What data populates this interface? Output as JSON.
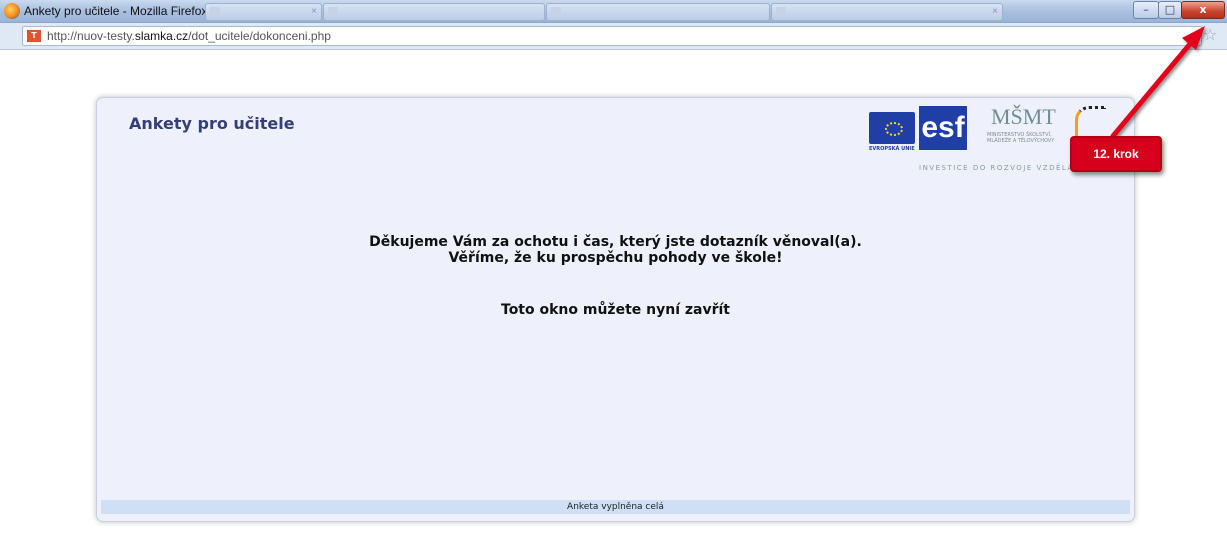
{
  "window": {
    "title": "Ankety pro učitele - Mozilla Firefox",
    "controls": {
      "minimize": "–",
      "maximize": "□",
      "close": "x"
    }
  },
  "tabs": [
    {
      "label": "Ankety pro učitele - Mozilla Firefox",
      "active": true
    },
    {
      "label": "",
      "active": false
    },
    {
      "label": "",
      "active": false
    },
    {
      "label": "",
      "active": false
    },
    {
      "label": "",
      "active": false
    }
  ],
  "address_bar": {
    "url_prefix": "http://nuov-testy.",
    "url_domain": "slamka.cz",
    "url_path": "/dot_ucitele/dokonceni.php"
  },
  "page": {
    "title": "Ankety pro učitele",
    "message_line1": "Děkujeme Vám za ochotu i čas, který jste dotazník věnoval(a).",
    "message_line2": "Věříme, že ku prospěchu pohody ve škole!",
    "close_message": "Toto okno můžete nyní zavřít",
    "footer": "Anketa vyplněna celá"
  },
  "logos": {
    "eu_text": "EVROPSKÁ UNIE",
    "esf_text": "esf",
    "msmt_text": "MŠMT",
    "msmt_sub": "MINISTERSTVO ŠKOLSTVÍ, MLÁDEŽE A TĚLOVÝCHOVY",
    "investice_text": "INVESTICE DO ROZVOJE VZDĚLÁ"
  },
  "annotation": {
    "label": "12. krok",
    "color": "#d6001c"
  },
  "icons": [
    "firefox-icon",
    "site-favicon",
    "bookmark-star-icon",
    "minimize-icon",
    "maximize-icon",
    "close-icon"
  ]
}
